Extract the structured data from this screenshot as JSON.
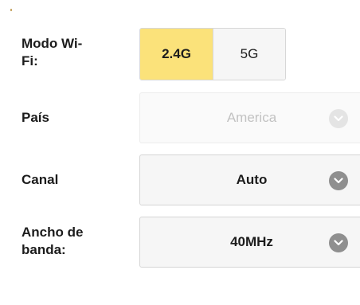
{
  "wifi_mode": {
    "label": "Modo Wi-\nFi:",
    "options": [
      "2.4G",
      "5G"
    ],
    "selected": "2.4G"
  },
  "country": {
    "label": "País",
    "value": "America",
    "disabled": true
  },
  "channel": {
    "label": "Canal",
    "value": "Auto"
  },
  "bandwidth": {
    "label": "Ancho de\nbanda:",
    "value": "40MHz"
  },
  "colors": {
    "accent": "#fbe27a",
    "chevron": "#8f8f8f",
    "chevron_disabled": "#e4e4e4"
  },
  "icons": {
    "dropdown": "chevron-down-icon"
  }
}
